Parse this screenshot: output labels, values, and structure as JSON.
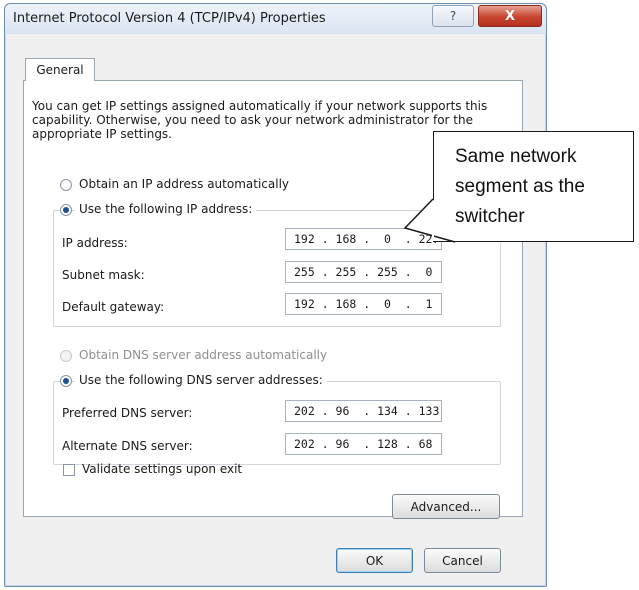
{
  "window": {
    "title": "Internet Protocol Version 4 (TCP/IPv4) Properties",
    "help_glyph": "?",
    "close_glyph": "X"
  },
  "tabs": [
    {
      "label": "General",
      "selected": true
    }
  ],
  "description": "You can get IP settings assigned automatically if your network supports this capability. Otherwise, you need to ask your network administrator for the appropriate IP settings.",
  "ip_settings": {
    "auto_option": "Obtain an IP address automatically",
    "manual_option": "Use the following IP address:",
    "manual_selected": true,
    "fields": [
      {
        "label": "IP address:",
        "value": "192 . 168 .  0  . 227"
      },
      {
        "label": "Subnet mask:",
        "value": "255 . 255 . 255 .  0"
      },
      {
        "label": "Default gateway:",
        "value": "192 . 168 .  0  .  1"
      }
    ]
  },
  "dns_settings": {
    "auto_option": "Obtain DNS server address automatically",
    "auto_enabled": false,
    "manual_option": "Use the following DNS server addresses:",
    "manual_selected": true,
    "fields": [
      {
        "label": "Preferred DNS server:",
        "value": "202 . 96  . 134 . 133"
      },
      {
        "label": "Alternate DNS server:",
        "value": "202 . 96  . 128 . 68"
      }
    ]
  },
  "validate": {
    "label": "Validate settings upon exit",
    "checked": false
  },
  "buttons": {
    "advanced": "Advanced...",
    "ok": "OK",
    "cancel": "Cancel"
  },
  "callout": {
    "text": "Same network\nsegment as the\nswitcher"
  },
  "colors": {
    "window_border": "#6f8fb0",
    "close_button": "#c7452f",
    "default_button_border": "#3c7fb1"
  }
}
